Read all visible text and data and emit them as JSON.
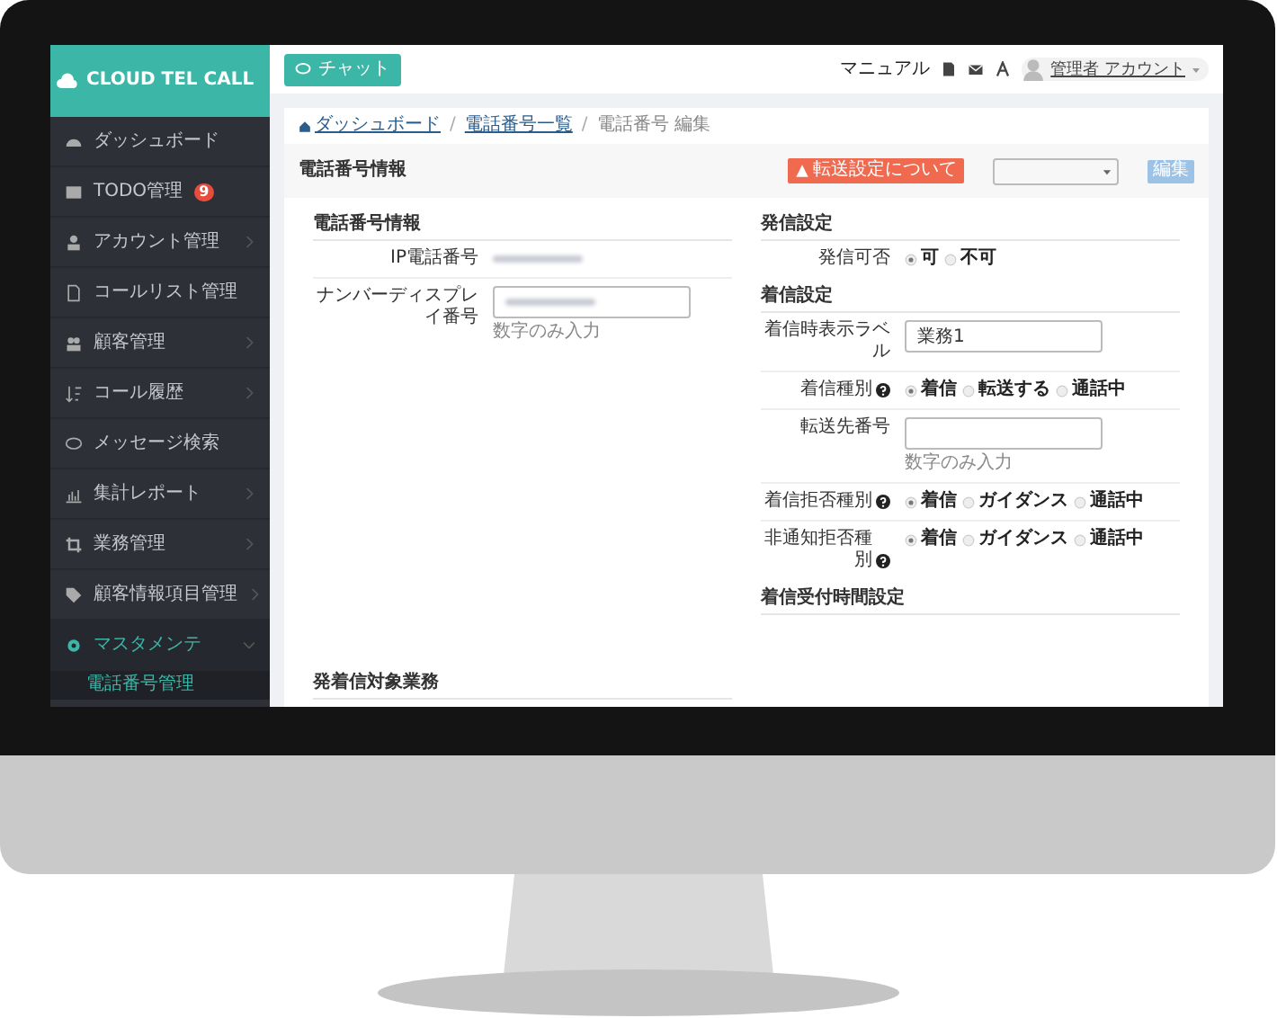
{
  "app": {
    "logo": "CLOUD TEL CALL"
  },
  "sidebar": {
    "items": [
      {
        "label": "ダッシュボード",
        "has_submenu": false,
        "selected": false
      },
      {
        "label": "TODO管理",
        "badge": "9",
        "has_submenu": false,
        "selected": false
      },
      {
        "label": "アカウント管理",
        "has_submenu": true,
        "expanded": false,
        "selected": false
      },
      {
        "label": "コールリスト管理",
        "has_submenu": false,
        "selected": false
      },
      {
        "label": "顧客管理",
        "has_submenu": true,
        "expanded": false,
        "selected": false
      },
      {
        "label": "コール履歴",
        "has_submenu": true,
        "expanded": false,
        "selected": false
      },
      {
        "label": "メッセージ検索",
        "has_submenu": false,
        "selected": false
      },
      {
        "label": "集計レポート",
        "has_submenu": true,
        "expanded": false,
        "selected": false
      },
      {
        "label": "業務管理",
        "has_submenu": true,
        "expanded": false,
        "selected": false
      },
      {
        "label": "顧客情報項目管理",
        "has_submenu": true,
        "expanded": false,
        "selected": false
      },
      {
        "label": "マスタメンテ",
        "has_submenu": true,
        "expanded": true,
        "selected": true,
        "children": [
          {
            "label": "電話番号管理",
            "selected": true
          }
        ]
      }
    ]
  },
  "topbar": {
    "chat_button": "チャット",
    "manual": "マニュアル",
    "user": "管理者 アカウント"
  },
  "breadcrumb": [
    {
      "label": "ダッシュボード",
      "link": true
    },
    {
      "separator": "/",
      "label": "電話番号一覧",
      "link": true
    },
    {
      "separator": "/",
      "label": "電話番号 編集",
      "link": false
    }
  ],
  "panel": {
    "title": "電話番号情報",
    "alert_button": "転送設定について",
    "edit_button": {
      "label": "編集",
      "disabled": true
    }
  },
  "left": {
    "sections": [
      {
        "title": "電話番号情報",
        "rows": [
          {
            "kind": "blurred_text",
            "label": "IP電話番号"
          },
          {
            "kind": "blurred_input",
            "label": "ナンバーディスプレイ番号",
            "hint": "数字のみ入力"
          }
        ]
      },
      {
        "title": "発着信対象業務"
      }
    ]
  },
  "right": {
    "sections": [
      {
        "title": "発信設定",
        "rows": [
          {
            "kind": "radio",
            "label": "発信可否",
            "options": [
              {
                "label": "可",
                "selected": true
              },
              {
                "label": "不可",
                "selected": false
              }
            ]
          }
        ]
      },
      {
        "title": "着信設定",
        "rows": [
          {
            "kind": "input",
            "label": "着信時表示ラベル",
            "value": "業務1"
          },
          {
            "kind": "radio",
            "label": "着信種別",
            "help": true,
            "options": [
              {
                "label": "着信",
                "selected": true
              },
              {
                "label": "転送する",
                "selected": false
              },
              {
                "label": "通話中",
                "selected": false
              }
            ]
          },
          {
            "kind": "input",
            "label": "転送先番号",
            "hint": "数字のみ入力"
          },
          {
            "kind": "radio",
            "label": "着信拒否種別",
            "help": true,
            "options": [
              {
                "label": "着信",
                "selected": true
              },
              {
                "label": "ガイダンス",
                "selected": false
              },
              {
                "label": "通話中",
                "selected": false
              }
            ]
          },
          {
            "kind": "radio",
            "label": "非通知拒否種別",
            "help": true,
            "options": [
              {
                "label": "着信",
                "selected": true
              },
              {
                "label": "ガイダンス",
                "selected": false
              },
              {
                "label": "通話中",
                "selected": false
              }
            ]
          }
        ]
      },
      {
        "title": "着信受付時間設定"
      }
    ]
  }
}
